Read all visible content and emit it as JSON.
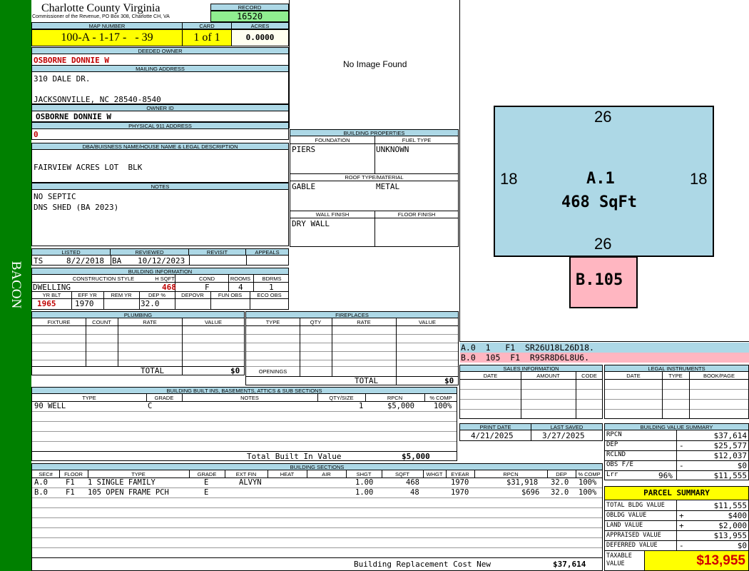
{
  "side_label": "BACON",
  "county": "Charlotte County Virginia",
  "commissioner": "Commissioner of the Revenue, PO Box 308, Charlotte CH, VA",
  "record": {
    "label": "RECORD",
    "value": "16520"
  },
  "map_number": {
    "label": "MAP NUMBER",
    "value": "100-A - 1-17 -   - 39"
  },
  "card": {
    "label": "CARD",
    "value": "1 of 1"
  },
  "acres": {
    "label": "ACRES",
    "value": "0.0000"
  },
  "deeded_owner": {
    "label": "DEEDED OWNER",
    "value": "OSBORNE DONNIE W"
  },
  "mailing_address": {
    "label": "MAILING ADDRESS",
    "line1": "310 DALE DR.",
    "line2": "JACKSONVILLE, NC 28540-8540"
  },
  "owner_id": {
    "label": "OWNER ID",
    "value": "OSBORNE DONNIE W"
  },
  "physical_address": {
    "label": "PHYSICAL 911 ADDRESS",
    "value": "0"
  },
  "dba": {
    "label": "DBA/BUISNESS NAME/HOUSE NAME & LEGAL DESCRIPTION",
    "value": "FAIRVIEW ACRES LOT  BLK"
  },
  "notes": {
    "label": "NOTES",
    "line1": "NO SEPTIC",
    "line2": "DNS SHED (BA 2023)"
  },
  "listing": {
    "listed_label": "LISTED",
    "reviewed_label": "REVIEWED",
    "revisit_label": "REVISIT",
    "appeals_label": "APPEALS",
    "listed_by": "TS",
    "listed_date": "8/2/2018",
    "reviewed_by": "BA",
    "reviewed_date": "10/12/2023"
  },
  "building_info": {
    "label": "BUILDING INFORMATION",
    "construction_style_label": "CONSTRUCTION STYLE",
    "hsqft_label": "H SQFT",
    "cond_label": "COND",
    "rooms_label": "ROOMS",
    "bdrms_label": "BDRMS",
    "construction_style": "DWELLING",
    "hsqft": "468",
    "cond": "F",
    "rooms": "4",
    "bdrms": "1",
    "yr_blt_label": "YR BLT",
    "eff_yr_label": "EFF YR",
    "rem_yr_label": "REM YR",
    "dep_label": "DEP %",
    "depovr_label": "DEPOVR",
    "fun_obs_label": "FUN OBS",
    "eco_obs_label": "ECO OBS",
    "yr_blt": "1965",
    "eff_yr": "1970",
    "dep": "32.0"
  },
  "image_placeholder": "No Image Found",
  "building_properties": {
    "label": "BUILDING PROPERTIES",
    "foundation_label": "FOUNDATION",
    "fuel_type_label": "FUEL TYPE",
    "foundation": "PIERS",
    "fuel_type": "UNKNOWN",
    "roof_label": "ROOF TYPE/MATERIAL",
    "roof_type": "GABLE",
    "roof_material": "METAL",
    "wall_finish_label": "WALL FINISH",
    "floor_finish_label": "FLOOR FINISH",
    "wall_finish": "DRY WALL"
  },
  "sketch": {
    "a_top": "26",
    "a_bottom": "26",
    "a_left": "18",
    "a_right": "18",
    "a_label": "A.1",
    "a_area": "468 SqFt",
    "b_label": "B.105",
    "legend_a": "A.0  1   F1  SR26U18L26D18.",
    "legend_b": "B.0  105  F1  R9SR8D6L8U6.",
    "color_a": "#add8e6",
    "color_b": "#ffb6c1"
  },
  "plumbing": {
    "label": "PLUMBING",
    "headers": [
      "FIXTURE",
      "COUNT",
      "RATE",
      "VALUE"
    ],
    "total_label": "TOTAL",
    "total": "$0"
  },
  "fireplaces": {
    "label": "FIREPLACES",
    "headers": [
      "TYPE",
      "QTY",
      "RATE",
      "VALUE"
    ],
    "openings_label": "OPENINGS",
    "total_label": "TOTAL",
    "total": "$0"
  },
  "sales": {
    "label": "SALES INFORMATION",
    "headers": [
      "DATE",
      "AMOUNT",
      "CODE"
    ]
  },
  "legal": {
    "label": "LEGAL INSTRUMENTS",
    "headers": [
      "DATE",
      "TYPE",
      "BOOK/PAGE"
    ]
  },
  "built_ins": {
    "label": "BUILDING BUILT INS, BASEMENTS, ATTICS & SUB SECTIONS",
    "headers": [
      "TYPE",
      "GRADE",
      "NOTES",
      "QTY/SIZE",
      "RPCN",
      "% COMP"
    ],
    "rows": [
      {
        "type": "90 WELL",
        "grade": "C",
        "notes": "",
        "qty": "1",
        "rpcn": "$5,000",
        "comp": "100%"
      }
    ],
    "total_label": "Total Built In Value",
    "total": "$5,000"
  },
  "dates": {
    "print_label": "PRINT DATE",
    "print_date": "4/21/2025",
    "saved_label": "LAST SAVED",
    "saved_date": "3/27/2025"
  },
  "value_summary": {
    "label": "BUILDING VALUE SUMMARY",
    "rows": [
      {
        "label": "RPCN",
        "sign": "",
        "pct": "",
        "value": "$37,614"
      },
      {
        "label": "DEP",
        "sign": "-",
        "pct": "",
        "value": "$25,577"
      },
      {
        "label": "RCLND",
        "sign": "",
        "pct": "",
        "value": "$12,037"
      },
      {
        "label": "OBS F/E",
        "sign": "-",
        "pct": "",
        "value": "$0"
      },
      {
        "label": "Lrr",
        "sign": "",
        "pct": "96%",
        "value": "$11,555"
      }
    ]
  },
  "sections": {
    "label": "BUILDING SECTIONS",
    "headers": [
      "SEC#",
      "FLOOR",
      "TYPE",
      "GRADE",
      "EXT FIN",
      "HEAT",
      "AIR",
      "SHGT",
      "SQFT",
      "WHGT",
      "EYEAR",
      "RPCN",
      "DEP",
      "% COMP"
    ],
    "rows": [
      {
        "sec": "A.0",
        "floor": "F1",
        "type": "1 SINGLE FAMILY",
        "grade": "E",
        "ext": "ALVYN",
        "heat": "",
        "air": "",
        "shgt": "1.00",
        "sqft": "468",
        "whgt": "",
        "eyear": "1970",
        "rpcn": "$31,918",
        "dep": "32.0",
        "comp": "100%"
      },
      {
        "sec": "B.0",
        "floor": "F1",
        "type": "105 OPEN FRAME PCH",
        "grade": "E",
        "ext": "",
        "heat": "",
        "air": "",
        "shgt": "1.00",
        "sqft": "48",
        "whgt": "",
        "eyear": "1970",
        "rpcn": "$696",
        "dep": "32.0",
        "comp": "100%"
      }
    ],
    "replacement_label": "Building Replacement Cost New",
    "replacement": "$37,614"
  },
  "parcel_summary": {
    "label": "PARCEL SUMMARY",
    "rows": [
      {
        "label": "TOTAL BLDG VALUE",
        "sign": "",
        "value": "$11,555"
      },
      {
        "label": "OBLDG VALUE",
        "sign": "+",
        "value": "$400"
      },
      {
        "label": "LAND VALUE",
        "sign": "+",
        "value": "$2,000"
      },
      {
        "label": "APPRAISED VALUE",
        "sign": "",
        "value": "$13,955"
      },
      {
        "label": "DEFERRED VALUE",
        "sign": "-",
        "value": "$0"
      }
    ],
    "taxable_label": "TAXABLE VALUE",
    "taxable": "$13,955"
  }
}
